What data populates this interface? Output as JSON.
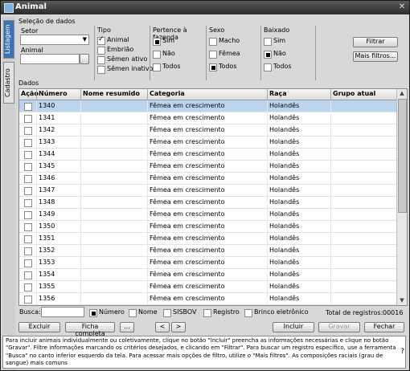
{
  "window": {
    "title": "Animal",
    "close_glyph": "✕"
  },
  "sidetabs": {
    "listagem": "Listagem",
    "cadastro": "Cadastro"
  },
  "filters": {
    "section_title": "Seleção de dados",
    "setor_label": "Setor",
    "animal_label": "Animal",
    "tipo": {
      "title": "Tipo",
      "options": [
        {
          "label": "Animal",
          "checked": true
        },
        {
          "label": "Embrião",
          "checked": false
        },
        {
          "label": "Sêmen ativo",
          "checked": false
        },
        {
          "label": "Sêmen inativo",
          "checked": false
        }
      ]
    },
    "pertence": {
      "title": "Pertence à fazenda",
      "options": [
        {
          "label": "Sim",
          "checked": true
        },
        {
          "label": "Não",
          "checked": false
        },
        {
          "label": "Todos",
          "checked": false
        }
      ]
    },
    "sexo": {
      "title": "Sexo",
      "options": [
        {
          "label": "Macho",
          "checked": false
        },
        {
          "label": "Fêmea",
          "checked": false
        },
        {
          "label": "Todos",
          "checked": true
        }
      ]
    },
    "baixado": {
      "title": "Baixado",
      "options": [
        {
          "label": "Sim",
          "checked": false
        },
        {
          "label": "Não",
          "checked": true
        },
        {
          "label": "Todos",
          "checked": false
        }
      ]
    },
    "filtrar_label": "Filtrar",
    "mais_filtros_label": "Mais filtros..."
  },
  "grid": {
    "section_title": "Dados",
    "columns": [
      "Ação",
      "Número",
      "Nome resumido",
      "Categoria",
      "Raça",
      "Grupo atual"
    ],
    "rows": [
      {
        "numero": "1340",
        "nome": "",
        "categoria": "Fêmea em crescimento",
        "raca": "Holandês",
        "grupo": ""
      },
      {
        "numero": "1341",
        "nome": "",
        "categoria": "Fêmea em crescimento",
        "raca": "Holandês",
        "grupo": ""
      },
      {
        "numero": "1342",
        "nome": "",
        "categoria": "Fêmea em crescimento",
        "raca": "Holandês",
        "grupo": ""
      },
      {
        "numero": "1343",
        "nome": "",
        "categoria": "Fêmea em crescimento",
        "raca": "Holandês",
        "grupo": ""
      },
      {
        "numero": "1344",
        "nome": "",
        "categoria": "Fêmea em crescimento",
        "raca": "Holandês",
        "grupo": ""
      },
      {
        "numero": "1345",
        "nome": "",
        "categoria": "Fêmea em crescimento",
        "raca": "Holandês",
        "grupo": ""
      },
      {
        "numero": "1346",
        "nome": "",
        "categoria": "Fêmea em crescimento",
        "raca": "Holandês",
        "grupo": ""
      },
      {
        "numero": "1347",
        "nome": "",
        "categoria": "Fêmea em crescimento",
        "raca": "Holandês",
        "grupo": ""
      },
      {
        "numero": "1348",
        "nome": "",
        "categoria": "Fêmea em crescimento",
        "raca": "Holandês",
        "grupo": ""
      },
      {
        "numero": "1349",
        "nome": "",
        "categoria": "Fêmea em crescimento",
        "raca": "Holandês",
        "grupo": ""
      },
      {
        "numero": "1350",
        "nome": "",
        "categoria": "Fêmea em crescimento",
        "raca": "Holandês",
        "grupo": ""
      },
      {
        "numero": "1351",
        "nome": "",
        "categoria": "Fêmea em crescimento",
        "raca": "Holandês",
        "grupo": ""
      },
      {
        "numero": "1352",
        "nome": "",
        "categoria": "Fêmea em crescimento",
        "raca": "Holandês",
        "grupo": ""
      },
      {
        "numero": "1353",
        "nome": "",
        "categoria": "Fêmea em crescimento",
        "raca": "Holandês",
        "grupo": ""
      },
      {
        "numero": "1354",
        "nome": "",
        "categoria": "Fêmea em crescimento",
        "raca": "Holandês",
        "grupo": ""
      },
      {
        "numero": "1355",
        "nome": "",
        "categoria": "Fêmea em crescimento",
        "raca": "Holandês",
        "grupo": ""
      },
      {
        "numero": "1356",
        "nome": "",
        "categoria": "Fêmea em crescimento",
        "raca": "Holandês",
        "grupo": ""
      }
    ],
    "selected_row": 0,
    "selected_color": "#bcd5ef"
  },
  "search": {
    "label": "Busca:",
    "value": "",
    "options": [
      {
        "label": "Número",
        "checked": true
      },
      {
        "label": "Nome",
        "checked": false
      },
      {
        "label": "SISBOV",
        "checked": false
      },
      {
        "label": "Registro",
        "checked": false
      },
      {
        "label": "Brinco eletrônico",
        "checked": false
      }
    ],
    "total_label": "Total de registros:",
    "total_value": "00016"
  },
  "buttons": {
    "excluir": "Excluir",
    "ficha": "Ficha completa",
    "blank": "...",
    "prev": "<",
    "next": ">",
    "incluir": "Incluir",
    "gravar": "Gravar",
    "fechar": "Fechar"
  },
  "help": {
    "text": "Para incluir animais individualmente ou coletivamente, clique no botão \"Incluir\" preencha as informações necessárias e clique no botão \"Gravar\". Filtre informações marcando os critérios desejados, e clicando em \"Filtrar\". Para buscar um registro específico, use a ferramenta \"Busca\" no canto inferior esquerdo da tela. Para acessar mais opções de filtro, utilize o \"Mais filtros\". As composições raciais (grau de sangue) mais comuns",
    "icon_glyph": "?"
  },
  "colors": {
    "accent": "#3b73b9",
    "title_bar": "#2c2c2c"
  }
}
